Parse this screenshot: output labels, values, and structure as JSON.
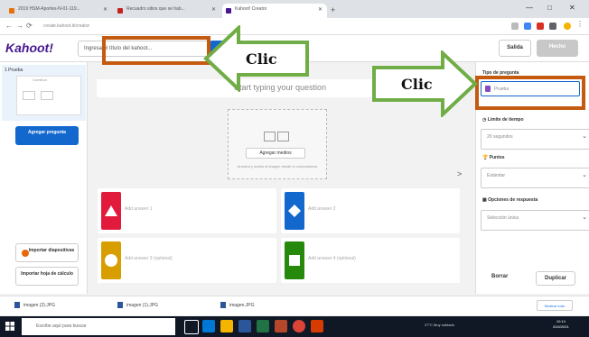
{
  "browser": {
    "tabs": [
      {
        "label": "2019 HSM-Aportes-N-01-119...",
        "color": "#e8710a"
      },
      {
        "label": "Recuadro sitios que se hab...",
        "color": "#c5221f"
      },
      {
        "label": "Kahoot! Creator",
        "color": "#46178f"
      }
    ],
    "new_tab": "+",
    "url": "create.kahoot.it/creator",
    "window_controls": [
      "—",
      "□",
      "✕"
    ]
  },
  "header": {
    "logo": "Kahoot!",
    "title_placeholder": "Ingresa el título del kahoot...",
    "exit_label": "Salida",
    "done_label": "Hecho"
  },
  "sidebar": {
    "slide_label": "1 Prueba",
    "slide_thumb_title": "Cuestion",
    "add_question": "Agregar pregunta",
    "import_slides": "Importar diapositivas",
    "import_sheet": "Importar hoja de cálculo"
  },
  "editor": {
    "question_placeholder": "Start typing your question",
    "add_media": "Agregar medios",
    "media_hint": "Arrastra y suelta la imagen desde tu computadora",
    "answers": [
      {
        "label": "Add answer 1",
        "color": "#e21b3c",
        "shape": "triangle"
      },
      {
        "label": "Add answer 2",
        "color": "#1368ce",
        "shape": "diamond"
      },
      {
        "label": "Add answer 3 (optional)",
        "color": "#d89e00",
        "shape": "circle"
      },
      {
        "label": "Add answer 4 (optional)",
        "color": "#26890c",
        "shape": "square"
      }
    ],
    "collapse": ">"
  },
  "settings_panel": {
    "question_type_label": "Tipo de pregunta",
    "question_type_value": "Prueba",
    "time_limit_label": "Límite de tiempo",
    "time_limit_value": "20 segundos",
    "points_label": "Puntos",
    "points_value": "Estándar",
    "answer_options_label": "Opciones de respuesta",
    "answer_options_value": "Selección única",
    "delete_label": "Borrar",
    "duplicate_label": "Duplicar"
  },
  "downloads": {
    "items": [
      "imagen (2).JPG",
      "imagen (1).JPG",
      "imagen.JPG"
    ],
    "show_all": "Mostrar todo"
  },
  "taskbar": {
    "search_placeholder": "Escribe aquí para buscar",
    "tray_text": "27°C Muy nublado",
    "time": "10:14",
    "date": "20/4/2021"
  },
  "annotations": {
    "left_callout": "Clic",
    "right_callout": "Clic",
    "box_color": "#c55a11",
    "arrow_color": "#70ad47"
  }
}
